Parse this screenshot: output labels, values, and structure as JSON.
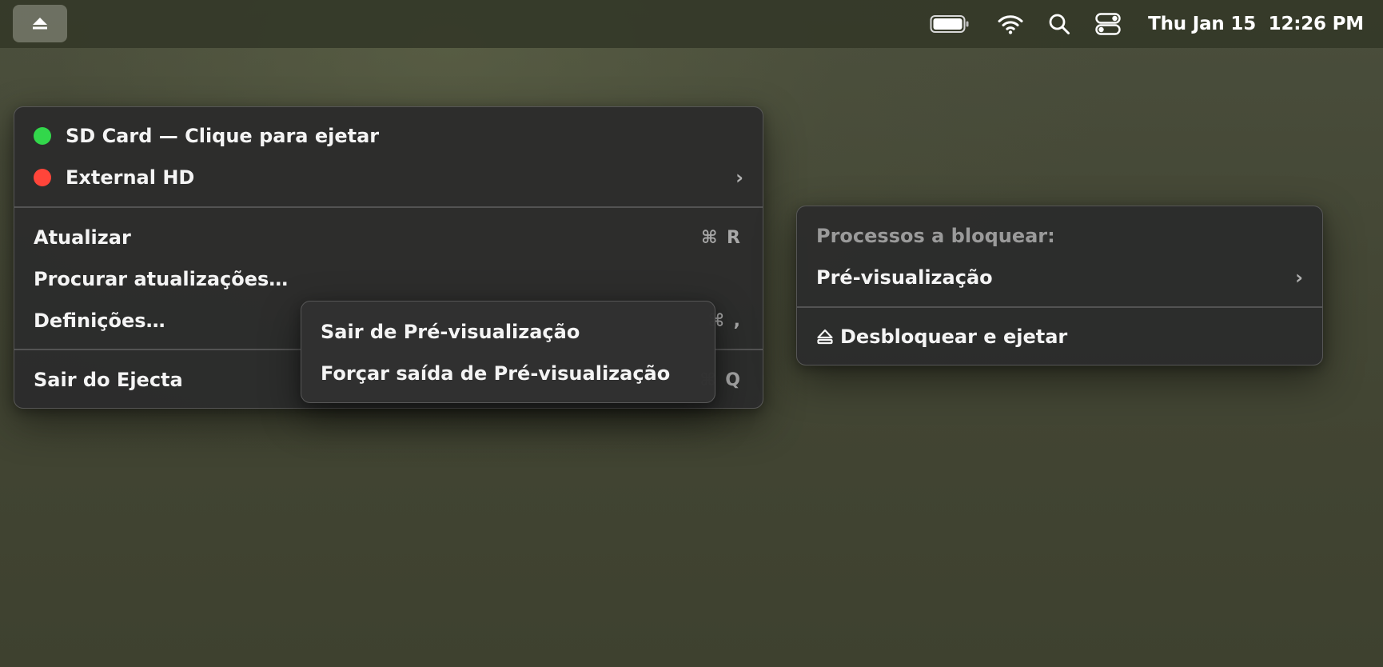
{
  "menubar": {
    "status_icon": "eject-icon",
    "battery_icon": "battery-icon",
    "wifi_icon": "wifi-icon",
    "search_icon": "search-icon",
    "control_center_icon": "control-center-icon",
    "clock": "Thu Jan 15  12:26 PM"
  },
  "main_menu": {
    "volumes": [
      {
        "label": "SD Card — Clique para ejetar",
        "status_color": "#32d74b",
        "has_submenu": false
      },
      {
        "label": "External HD",
        "status_color": "#ff453a",
        "has_submenu": true,
        "chevron": "›"
      }
    ],
    "refresh": {
      "label": "Atualizar",
      "shortcut": "⌘ R"
    },
    "check_updates": {
      "label": "Procurar atualizações…"
    },
    "settings": {
      "label": "Definições…",
      "shortcut": "⌘ ,"
    },
    "quit": {
      "label": "Sair do Ejecta",
      "shortcut": "⌘ Q"
    }
  },
  "process_menu": {
    "header": "Processos a bloquear:",
    "process": {
      "label": "Pré-visualização",
      "chevron": "›"
    },
    "unblock_eject": {
      "icon": "eject-icon",
      "label": "Desbloquear e ejetar"
    }
  },
  "process_submenu": {
    "quit": "Sair de Pré-visualização",
    "force_quit": "Forçar saída de Pré-visualização"
  },
  "colors": {
    "green_status": "#32d74b",
    "red_status": "#ff453a",
    "menu_bg": "#2c2c2c"
  }
}
